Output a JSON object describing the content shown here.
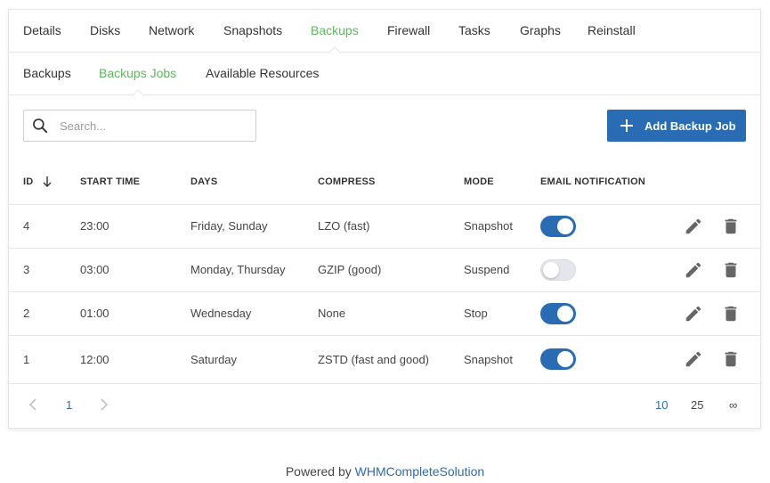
{
  "tabs": [
    "Details",
    "Disks",
    "Network",
    "Snapshots",
    "Backups",
    "Firewall",
    "Tasks",
    "Graphs",
    "Reinstall"
  ],
  "active_tab": "Backups",
  "subtabs": [
    "Backups",
    "Backups Jobs",
    "Available Resources"
  ],
  "active_subtab": "Backups Jobs",
  "search": {
    "placeholder": "Search...",
    "value": ""
  },
  "add_button": {
    "label": "Add Backup Job"
  },
  "table": {
    "headers": {
      "id": "ID",
      "start_time": "START TIME",
      "days": "DAYS",
      "compress": "COMPRESS",
      "mode": "MODE",
      "email": "EMAIL NOTIFICATION"
    },
    "rows": [
      {
        "id": "4",
        "start_time": "23:00",
        "days": "Friday, Sunday",
        "compress": "LZO (fast)",
        "mode": "Snapshot",
        "email": true
      },
      {
        "id": "3",
        "start_time": "03:00",
        "days": "Monday, Thursday",
        "compress": "GZIP (good)",
        "mode": "Suspend",
        "email": false
      },
      {
        "id": "2",
        "start_time": "01:00",
        "days": "Wednesday",
        "compress": "None",
        "mode": "Stop",
        "email": true
      },
      {
        "id": "1",
        "start_time": "12:00",
        "days": "Saturday",
        "compress": "ZSTD (fast and good)",
        "mode": "Snapshot",
        "email": true
      }
    ]
  },
  "pagination": {
    "current_page": "1",
    "page_sizes": [
      "10",
      "25",
      "∞"
    ],
    "active_page_size": "10"
  },
  "footer": {
    "prefix": "Powered by ",
    "link": "WHMCompleteSolution"
  },
  "colors": {
    "accent_green": "#5fb760",
    "primary_blue": "#2a6cb4",
    "icon_gray": "#666666"
  },
  "icons": {
    "search": "search-icon",
    "sort": "arrow-down-icon",
    "add": "plus-icon",
    "edit": "pencil-icon",
    "delete": "trash-icon",
    "prev": "chevron-left-icon",
    "next": "chevron-right-icon"
  }
}
